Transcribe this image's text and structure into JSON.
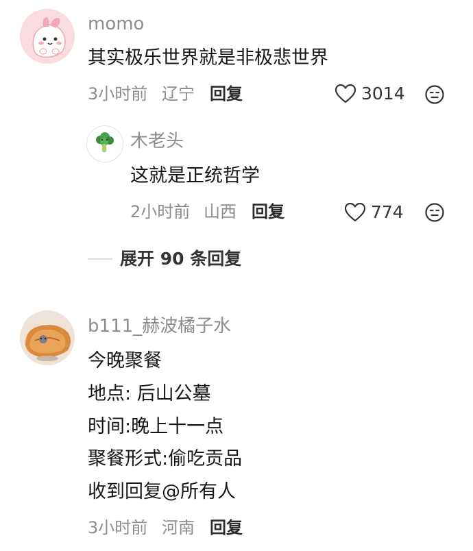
{
  "comments": [
    {
      "username": "momo",
      "text": "其实极乐世界就是非极悲世界",
      "time": "3小时前",
      "location": "辽宁",
      "reply_label": "回复",
      "likes": "3014",
      "avatar_icon": "pink-bunny-avatar",
      "replies": [
        {
          "username": "木老头",
          "text": "这就是正统哲学",
          "time": "2小时前",
          "location": "山西",
          "reply_label": "回复",
          "likes": "774",
          "avatar_icon": "broccoli-avatar"
        }
      ],
      "expand_label": "展开 90 条回复"
    },
    {
      "username": "b111_赫波橘子水",
      "text_lines": [
        "今晚聚餐",
        "地点: 后山公墓",
        "时间:晚上十一点",
        "聚餐形式:偷吃贡品",
        "收到回复@所有人"
      ],
      "time": "3小时前",
      "location": "河南",
      "reply_label": "回复",
      "avatar_icon": "bread-cat-avatar"
    }
  ],
  "colors": {
    "meta_gray": "#8c8c8c",
    "text_dark": "#161616",
    "avatar_pink": "#f7d2d6"
  },
  "icons": {
    "like": "heart-outline-icon",
    "dislike": "neutral-face-icon"
  }
}
